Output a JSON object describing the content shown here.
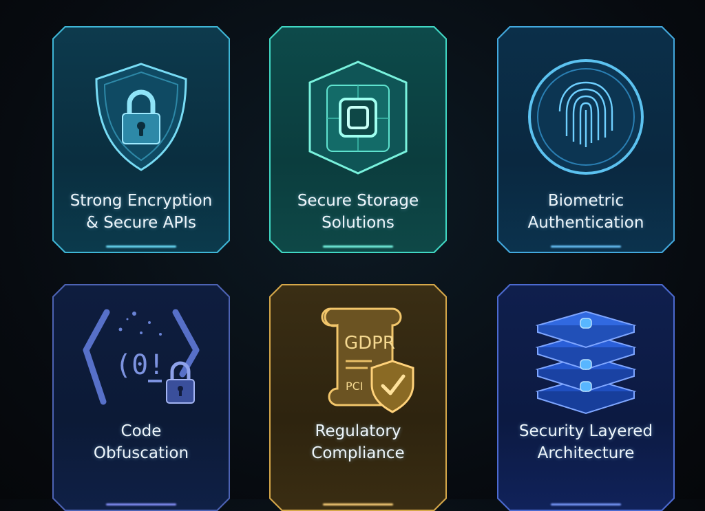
{
  "cards": [
    {
      "line1": "Strong Encryption",
      "line2": "& Secure APIs",
      "icon": "shield-lock-icon"
    },
    {
      "line1": "Secure Storage",
      "line2": "Solutions",
      "icon": "secure-chip-icon"
    },
    {
      "line1": "Biometric",
      "line2": "Authentication",
      "icon": "fingerprint-icon"
    },
    {
      "line1": "Code",
      "line2": "Obfuscation",
      "icon": "code-obfuscation-icon"
    },
    {
      "line1": "Regulatory",
      "line2": "Compliance",
      "icon": "compliance-scroll-icon",
      "scroll_text_1": "GDPR",
      "scroll_text_2": "PCI"
    },
    {
      "line1": "Security Layered",
      "line2": "Architecture",
      "icon": "layered-stack-icon"
    }
  ],
  "colors": {
    "cyan": "#3fb6d6",
    "teal": "#41d8c4",
    "blue": "#43a9de",
    "indigo": "#4d63b4",
    "gold": "#d6a84a",
    "royal": "#4c6ad0"
  }
}
